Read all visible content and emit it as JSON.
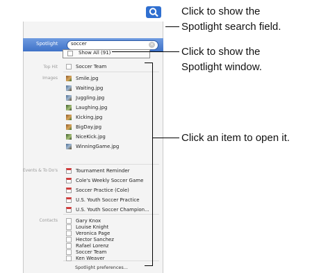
{
  "callouts": {
    "search_field_1": "Click to show the",
    "search_field_2": "Spotlight search field.",
    "window_1": "Click to show the",
    "window_2": "Spotlight window.",
    "open_item": "Click an item to open it."
  },
  "spotlight": {
    "header_label": "Spotlight",
    "query": "soccer",
    "show_all": "Show All (91)",
    "categories": {
      "top_hit": "Top Hit",
      "images": "Images",
      "events": "Events & To Do's",
      "contacts": "Contacts"
    },
    "top_hit": [
      "Soccer Team"
    ],
    "images": [
      "Smile.jpg",
      "Waiting.jpg",
      "Juggling.jpg",
      "Laughing.jpg",
      "Kicking.jpg",
      "BigDay.jpg",
      "NiceKick.jpg",
      "WinningGame.jpg"
    ],
    "events": [
      "Tournament Reminder",
      "Cole's Weekly Soccer Game",
      "Soccer Practice (Cole)",
      "U.S. Youth Soccer Practice",
      "U.S. Youth Soccer Champion..."
    ],
    "contacts": [
      "Gary Knox",
      "Louise Knight",
      "Veronica Page",
      "Hector Sanchez",
      "Rafael Lorenz",
      "Soccer Team",
      "Ken Weaver"
    ],
    "preferences": "Spotlight preferences..."
  },
  "colors": {
    "header": "#3f72c8",
    "event_icon": "#d23b3b"
  }
}
